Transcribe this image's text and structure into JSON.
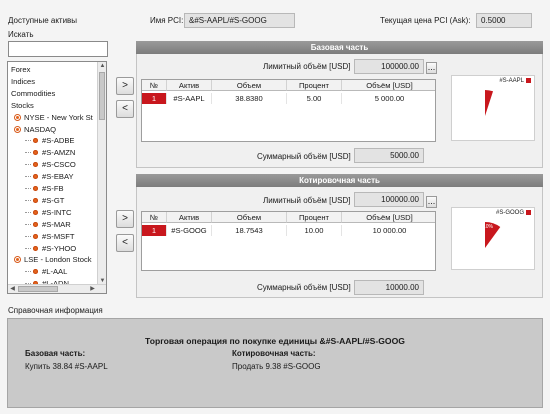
{
  "left": {
    "assets_label": "Доступные активы",
    "search_label": "Искать",
    "search_value": "",
    "tree": [
      {
        "label": "Forex",
        "level": 0,
        "icon": "none"
      },
      {
        "label": "Indices",
        "level": 0,
        "icon": "none"
      },
      {
        "label": "Commodities",
        "level": 0,
        "icon": "none"
      },
      {
        "label": "Stocks",
        "level": 0,
        "icon": "none"
      },
      {
        "label": "NYSE - New York St",
        "level": 1,
        "icon": "exchange-icon"
      },
      {
        "label": "NASDAQ",
        "level": 1,
        "icon": "exchange-icon"
      },
      {
        "label": "#S-ADBE",
        "level": 2,
        "icon": "stock-icon"
      },
      {
        "label": "#S-AMZN",
        "level": 2,
        "icon": "stock-icon"
      },
      {
        "label": "#S-CSCO",
        "level": 2,
        "icon": "stock-icon"
      },
      {
        "label": "#S-EBAY",
        "level": 2,
        "icon": "stock-icon"
      },
      {
        "label": "#S-FB",
        "level": 2,
        "icon": "stock-icon"
      },
      {
        "label": "#S-GT",
        "level": 2,
        "icon": "stock-icon"
      },
      {
        "label": "#S-INTC",
        "level": 2,
        "icon": "stock-icon"
      },
      {
        "label": "#S-MAR",
        "level": 2,
        "icon": "stock-icon"
      },
      {
        "label": "#S-MSFT",
        "level": 2,
        "icon": "stock-icon"
      },
      {
        "label": "#S-YHOO",
        "level": 2,
        "icon": "stock-icon"
      },
      {
        "label": "LSE - London Stock",
        "level": 1,
        "icon": "exchange-icon"
      },
      {
        "label": "#L-AAL",
        "level": 2,
        "icon": "stock-icon"
      },
      {
        "label": "#L-ADN",
        "level": 2,
        "icon": "stock-icon"
      }
    ]
  },
  "header": {
    "pci_name_label": "Имя PCI:",
    "pci_name_value": "&#S-AAPL/#S-GOOG",
    "pci_price_label": "Текущая цена PCI (Ask):",
    "pci_price_value": "0.5000"
  },
  "buttons": {
    "move_right": ">",
    "move_left": "<",
    "browse": "..."
  },
  "base": {
    "title": "Базовая часть",
    "limit_label": "Лимитный объём [USD]",
    "limit_value": "100000.00",
    "columns": [
      "№",
      "Актив",
      "Объем",
      "Процент",
      "Объём [USD]"
    ],
    "rows": [
      [
        "1",
        "#S-AAPL",
        "38.8380",
        "5.00",
        "5 000.00"
      ]
    ],
    "total_label": "Суммарный объём [USD]",
    "total_value": "5000.00",
    "legend": "#S-AAPL",
    "chart_pct": 5
  },
  "quote": {
    "title": "Котировочная часть",
    "limit_label": "Лимитный объём [USD]",
    "limit_value": "100000.00",
    "columns": [
      "№",
      "Актив",
      "Объем",
      "Процент",
      "Объём [USD]"
    ],
    "rows": [
      [
        "1",
        "#S-GOOG",
        "18.7543",
        "10.00",
        "10 000.00"
      ]
    ],
    "total_label": "Суммарный объём [USD]",
    "total_value": "10000.00",
    "legend": "#S-GOOG",
    "chart_pct": 10,
    "slice_label": "10%"
  },
  "info": {
    "label": "Справочная информация",
    "title": "Торговая операция по покупке единицы &#S-AAPL/#S-GOOG",
    "base_heading": "Базовая часть:",
    "base_text": "Купить 38.84 #S-AAPL",
    "quote_heading": "Котировочная часть:",
    "quote_text": "Продать 9.38 #S-GOOG"
  },
  "colors": {
    "accent": "#c8171d",
    "panel_header": "#8a8a8a",
    "info_bg": "#c9c9c9"
  }
}
